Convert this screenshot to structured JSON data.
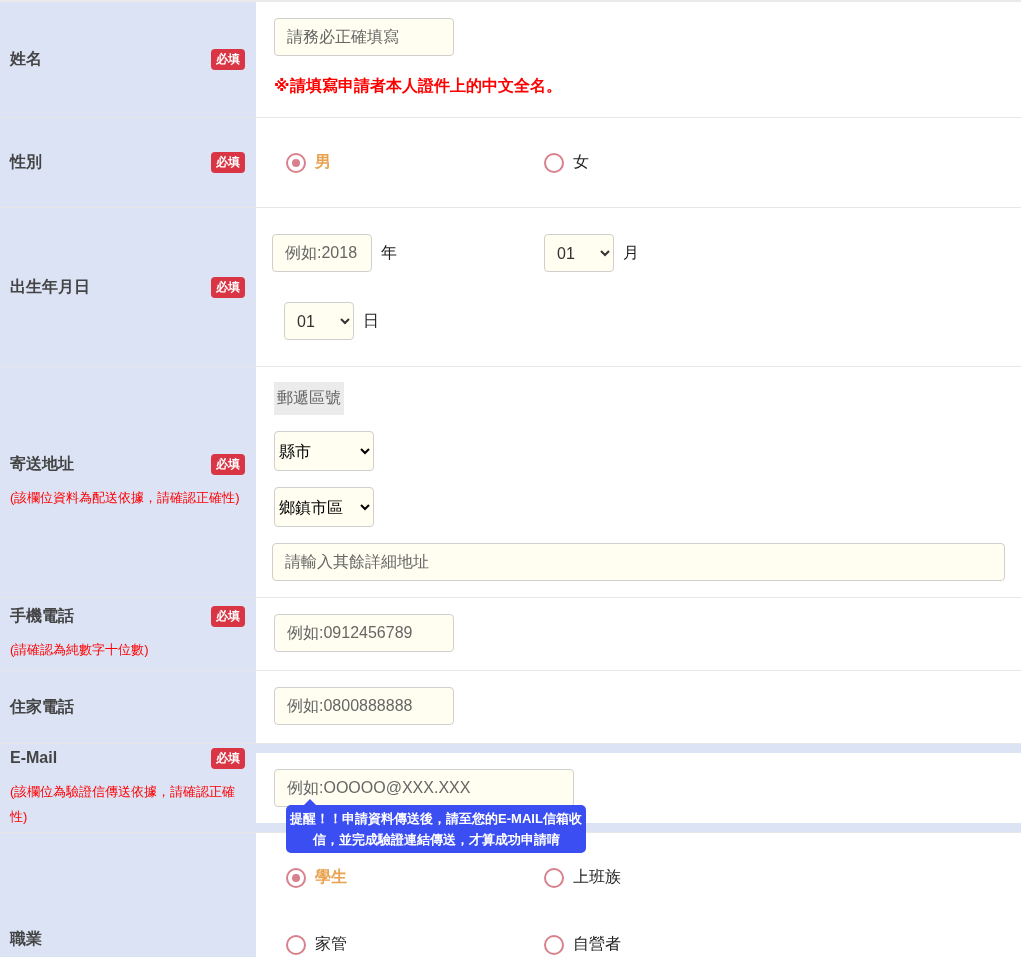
{
  "rows": [
    {
      "kind": "text",
      "label": "姓名",
      "badge": "必填",
      "input": {
        "placeholder": "請務必正確填寫"
      },
      "hint": "※請填寫申請者本人證件上的中文全名。"
    },
    {
      "kind": "radio",
      "label": "性別",
      "badge": "必填",
      "options": [
        {
          "label": "男",
          "selected": true
        },
        {
          "label": "女",
          "selected": false
        }
      ]
    },
    {
      "kind": "date",
      "label": "出生年月日",
      "badge": "必填",
      "parts": [
        {
          "kind": "input",
          "placeholder": "例如:2018",
          "unit": "年"
        },
        {
          "kind": "select",
          "value": "01",
          "unit": "月"
        },
        {
          "kind": "select",
          "value": "01",
          "unit": "日"
        }
      ]
    },
    {
      "kind": "address",
      "label": "寄送地址",
      "badge": "必填",
      "note": "(該欄位資料為配送依據，請確認正確性)",
      "zip": "郵遞區號",
      "city": "縣市",
      "district": "鄉鎮市區",
      "input": {
        "placeholder": "請輸入其餘詳細地址"
      }
    },
    {
      "kind": "text",
      "label": "手機電話",
      "badge": "必填",
      "note": "(請確認為純數字十位數)",
      "input": {
        "placeholder": "例如:0912456789"
      }
    },
    {
      "kind": "text",
      "label": "住家電話",
      "input": {
        "placeholder": "例如:0800888888"
      }
    },
    {
      "kind": "email",
      "label": "E-Mail",
      "badge": "必填",
      "note": "(該欄位為驗證信傳送依據，請確認正確性)",
      "input": {
        "placeholder": "例如:OOOOO@XXX.XXX"
      },
      "tooltip": "提醒！！申請資料傳送後，請至您的E-MAIL信箱收信，並完成驗證連結傳送，才算成功申請唷"
    },
    {
      "kind": "radio",
      "label": "職業",
      "options": [
        {
          "label": "學生",
          "selected": true
        },
        {
          "label": "上班族",
          "selected": false
        },
        {
          "label": "家管",
          "selected": false
        },
        {
          "label": "自營者",
          "selected": false
        }
      ]
    }
  ]
}
